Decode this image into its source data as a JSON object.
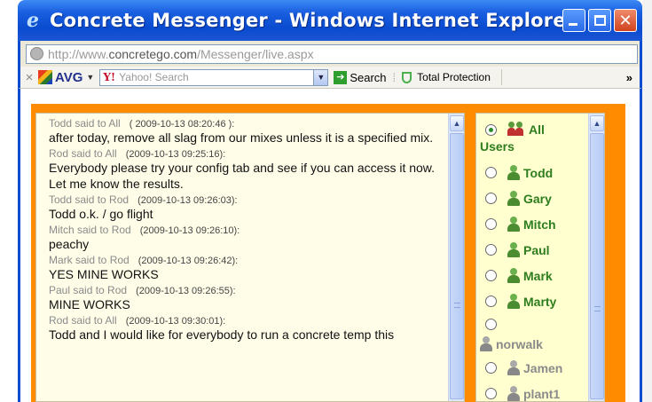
{
  "window": {
    "title": "Concrete Messenger - Windows Internet Explorer",
    "ie_icon": "ie-logo-icon",
    "title_gradient_color": "#0a4bd0"
  },
  "address": {
    "url_prefix": "http://www.",
    "url_domain": "concretego.com",
    "url_path": "/Messenger/live.aspx"
  },
  "toolbar": {
    "close_glyph": "×",
    "avg_label": "AVG",
    "yahoo_logo": "Y!",
    "search_placeholder": "Yahoo! Search",
    "search_label": "Search",
    "total_protection_label": "Total Protection",
    "chevron": "»"
  },
  "chat": {
    "messages": [
      {
        "from": "Todd said to All",
        "timestamp": "( 2009-10-13 08:20:46 ):",
        "text": "after today, remove all slag from our mixes unless it is a specified mix."
      },
      {
        "from": "Rod said to All",
        "timestamp": "(2009-10-13 09:25:16):",
        "text": "Everybody please try your config tab and see if you can access it now. Let me know the results."
      },
      {
        "from": "Todd said to Rod",
        "timestamp": "(2009-10-13 09:26:03):",
        "text": "Todd o.k. / go flight"
      },
      {
        "from": "Mitch said to Rod",
        "timestamp": "(2009-10-13 09:26:10):",
        "text": "peachy"
      },
      {
        "from": "Mark said to Rod",
        "timestamp": "(2009-10-13 09:26:42):",
        "text": "YES MINE WORKS"
      },
      {
        "from": "Paul said to Rod",
        "timestamp": "(2009-10-13 09:26:55):",
        "text": "MINE WORKS"
      },
      {
        "from": "Rod said to All",
        "timestamp": "(2009-10-13 09:30:01):",
        "text": "Todd and I would like for everybody to run a concrete temp this"
      }
    ]
  },
  "users": {
    "all_label": "All",
    "users_label": "Users",
    "list": [
      {
        "name": "Todd",
        "status": "online"
      },
      {
        "name": "Gary",
        "status": "online"
      },
      {
        "name": "Mitch",
        "status": "online"
      },
      {
        "name": "Paul",
        "status": "online"
      },
      {
        "name": "Mark",
        "status": "online"
      },
      {
        "name": "Marty",
        "status": "online"
      },
      {
        "name": "norwalk",
        "status": "offline"
      },
      {
        "name": "Jamen",
        "status": "offline"
      },
      {
        "name": "plant1",
        "status": "offline"
      }
    ]
  },
  "colors": {
    "page_background": "#ff8c00",
    "chat_background": "#fffde8",
    "users_background": "#ffffd0",
    "online_user": "#2e7d1e",
    "offline_user": "#8a8a8a"
  }
}
